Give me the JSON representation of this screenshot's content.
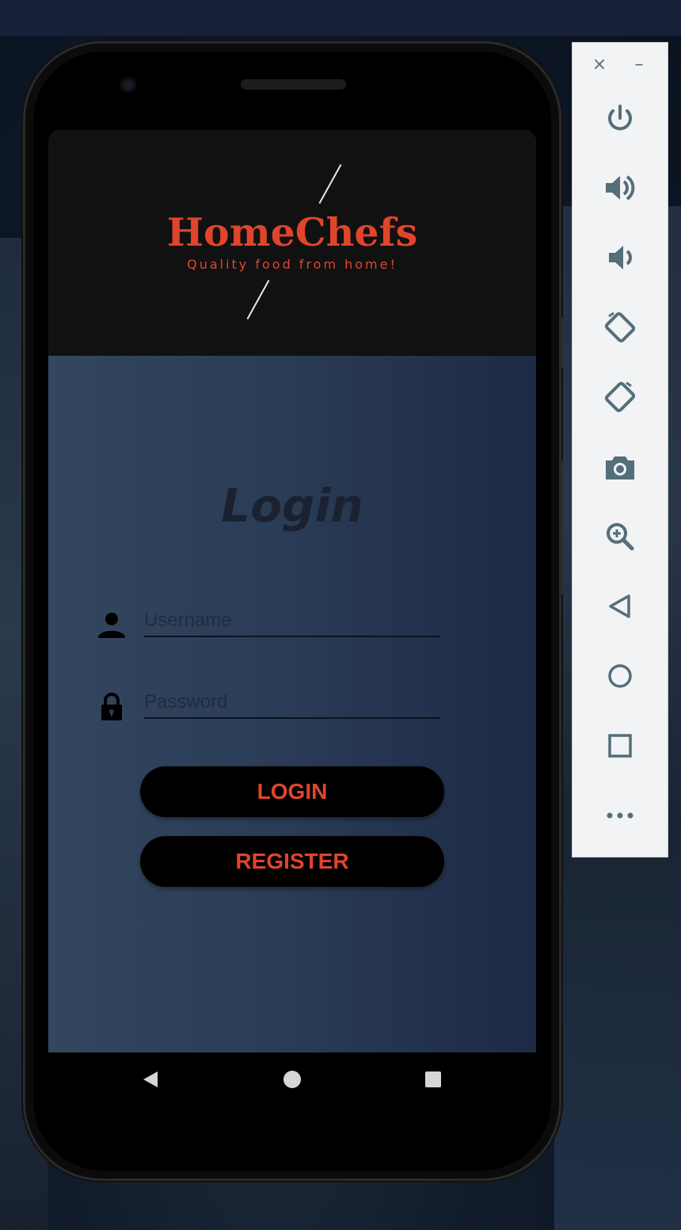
{
  "app": {
    "brand_name": "HomeChefs",
    "tagline": "Quality food from home!",
    "accent_color": "#e0452b"
  },
  "login": {
    "title": "Login",
    "username_placeholder": "Username",
    "password_placeholder": "Password",
    "login_button": "LOGIN",
    "register_button": "REGISTER"
  },
  "icons": {
    "username": "person-icon",
    "password": "lock-icon",
    "nav": [
      "back-icon",
      "home-icon",
      "recents-icon"
    ]
  },
  "emulator_toolbar": {
    "window_controls": {
      "close": "×",
      "minimize": "–"
    },
    "buttons": [
      "power-icon",
      "volume-up-icon",
      "volume-down-icon",
      "rotate-left-icon",
      "rotate-right-icon",
      "camera-icon",
      "zoom-icon",
      "back-icon",
      "home-icon",
      "overview-icon",
      "more-icon"
    ]
  }
}
